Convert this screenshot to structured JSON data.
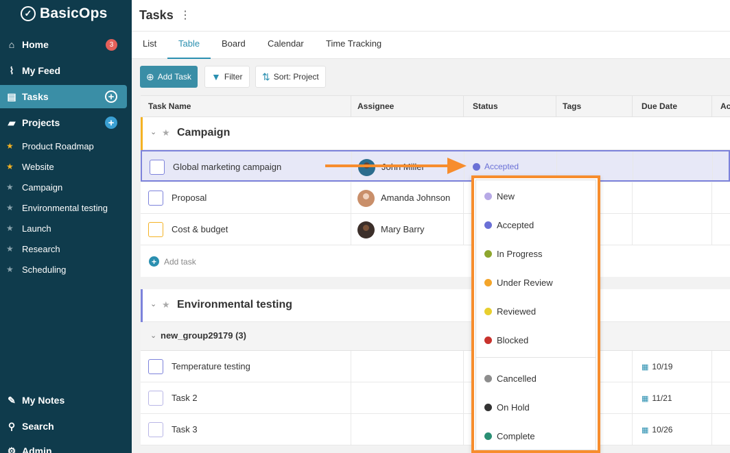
{
  "app": {
    "name": "BasicOps"
  },
  "sidebar": {
    "home": {
      "label": "Home",
      "badge": "3"
    },
    "feed": {
      "label": "My Feed"
    },
    "tasks": {
      "label": "Tasks"
    },
    "projects": {
      "label": "Projects"
    },
    "project_items": [
      {
        "label": "Product Roadmap",
        "favorite": true
      },
      {
        "label": "Website",
        "favorite": true
      },
      {
        "label": "Campaign",
        "favorite": false
      },
      {
        "label": "Environmental testing",
        "favorite": false
      },
      {
        "label": "Launch",
        "favorite": false
      },
      {
        "label": "Research",
        "favorite": false
      },
      {
        "label": "Scheduling",
        "favorite": false
      }
    ],
    "notes": {
      "label": "My Notes"
    },
    "search": {
      "label": "Search"
    },
    "admin": {
      "label": "Admin"
    }
  },
  "header": {
    "title": "Tasks"
  },
  "tabs": [
    {
      "label": "List"
    },
    {
      "label": "Table",
      "active": true
    },
    {
      "label": "Board"
    },
    {
      "label": "Calendar"
    },
    {
      "label": "Time Tracking"
    }
  ],
  "toolbar": {
    "add_task": "Add Task",
    "filter": "Filter",
    "sort": "Sort: Project"
  },
  "table": {
    "columns": [
      "Task Name",
      "Assignee",
      "Status",
      "Tags",
      "Due Date",
      "Ac"
    ],
    "groups": [
      {
        "name": "Campaign",
        "color": "#f4b223",
        "rows": [
          {
            "task": "Global marketing campaign",
            "assignee": "John Miller",
            "status": "Accepted",
            "due": ""
          },
          {
            "task": "Proposal",
            "assignee": "Amanda Johnson",
            "status": "",
            "due": ""
          },
          {
            "task": "Cost & budget",
            "assignee": "Mary Barry",
            "status": "",
            "due": ""
          }
        ],
        "add_task": "Add task"
      },
      {
        "name": "Environmental testing",
        "color": "#7c82db",
        "subgroup": "new_group29179 (3)",
        "rows": [
          {
            "task": "Temperature testing",
            "assignee": "",
            "status": "",
            "due": "10/19"
          },
          {
            "task": "Task 2",
            "assignee": "",
            "status": "",
            "due": "11/21"
          },
          {
            "task": "Task 3",
            "assignee": "",
            "status": "",
            "due": "10/26"
          }
        ]
      }
    ]
  },
  "status_dropdown": {
    "options": [
      {
        "label": "New",
        "color": "#b7a9e6"
      },
      {
        "label": "Accepted",
        "color": "#6a70d6"
      },
      {
        "label": "In Progress",
        "color": "#8ea62e"
      },
      {
        "label": "Under Review",
        "color": "#f4a52a"
      },
      {
        "label": "Reviewed",
        "color": "#e8cf2e"
      },
      {
        "label": "Blocked",
        "color": "#c8322d"
      },
      {
        "label": "Cancelled",
        "color": "#8d8d8d"
      },
      {
        "label": "On Hold",
        "color": "#333333"
      },
      {
        "label": "Complete",
        "color": "#2a8f74"
      }
    ]
  },
  "colors": {
    "sidebar_bg": "#0f3b4c",
    "accent": "#3a8ea6",
    "highlight": "#f78d2d"
  }
}
